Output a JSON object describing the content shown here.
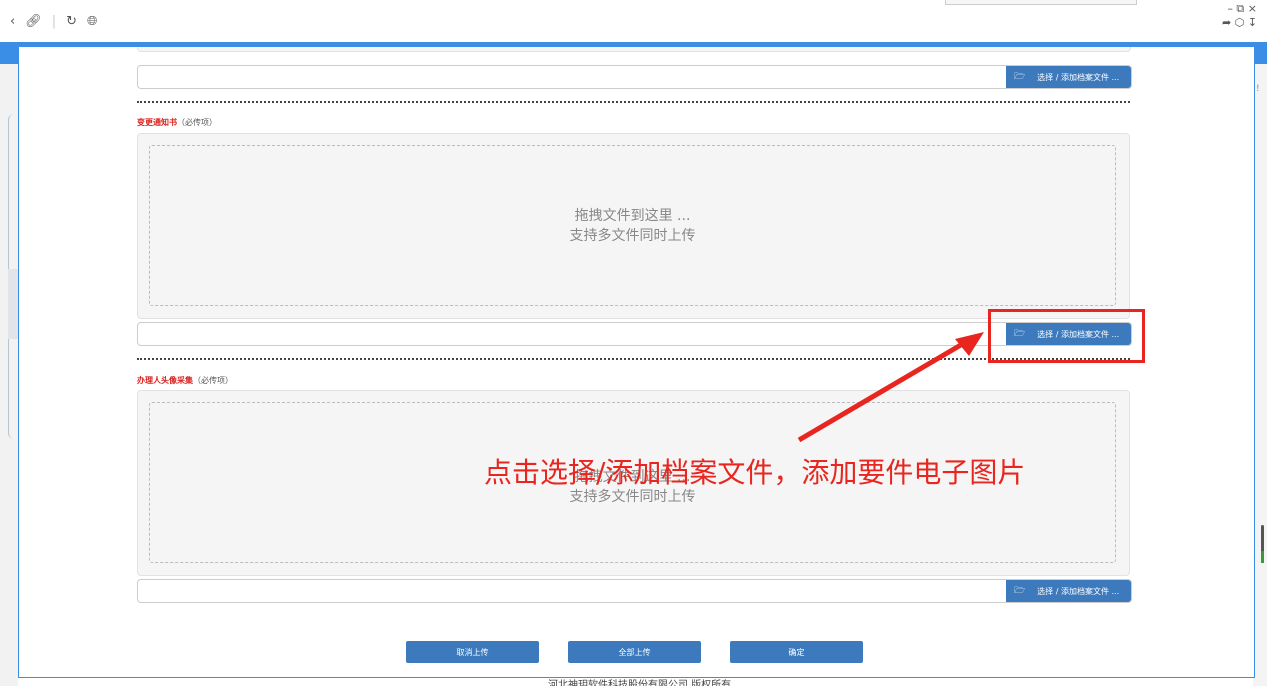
{
  "browser": {
    "nav_icons": [
      "back-icon",
      "link-icon",
      "refresh-icon",
      "globe-icon"
    ],
    "window_controls": "– ⧉ ×",
    "right_icons": [
      "share-icon",
      "extension-icon",
      "download-icon"
    ]
  },
  "sections": [
    {
      "title": "",
      "required_label": "",
      "file_button": "选择 / 添加档案文件 ..."
    },
    {
      "title": "变更通知书",
      "required_label": "（必传项）",
      "drop_line1": "拖拽文件到这里 ...",
      "drop_line2": "支持多文件同时上传",
      "file_button": "选择 / 添加档案文件 ..."
    },
    {
      "title": "办理人头像采集",
      "required_label": "（必传项）",
      "drop_line1": "拖拽文件到这里 ...",
      "drop_line2": "支持多文件同时上传",
      "file_button": "选择 / 添加档案文件 ..."
    }
  ],
  "actions": {
    "cancel": "取消上传",
    "upload_all": "全部上传",
    "confirm": "确定"
  },
  "annotation": {
    "text": "点击选择/添加档案文件，添加要件电子图片",
    "color": "#e8261f"
  },
  "footer": "河北神玥软件科技股份有限公司 版权所有",
  "colors": {
    "accent": "#3a8ee6",
    "button": "#3c7abd",
    "required": "#d9201c"
  }
}
